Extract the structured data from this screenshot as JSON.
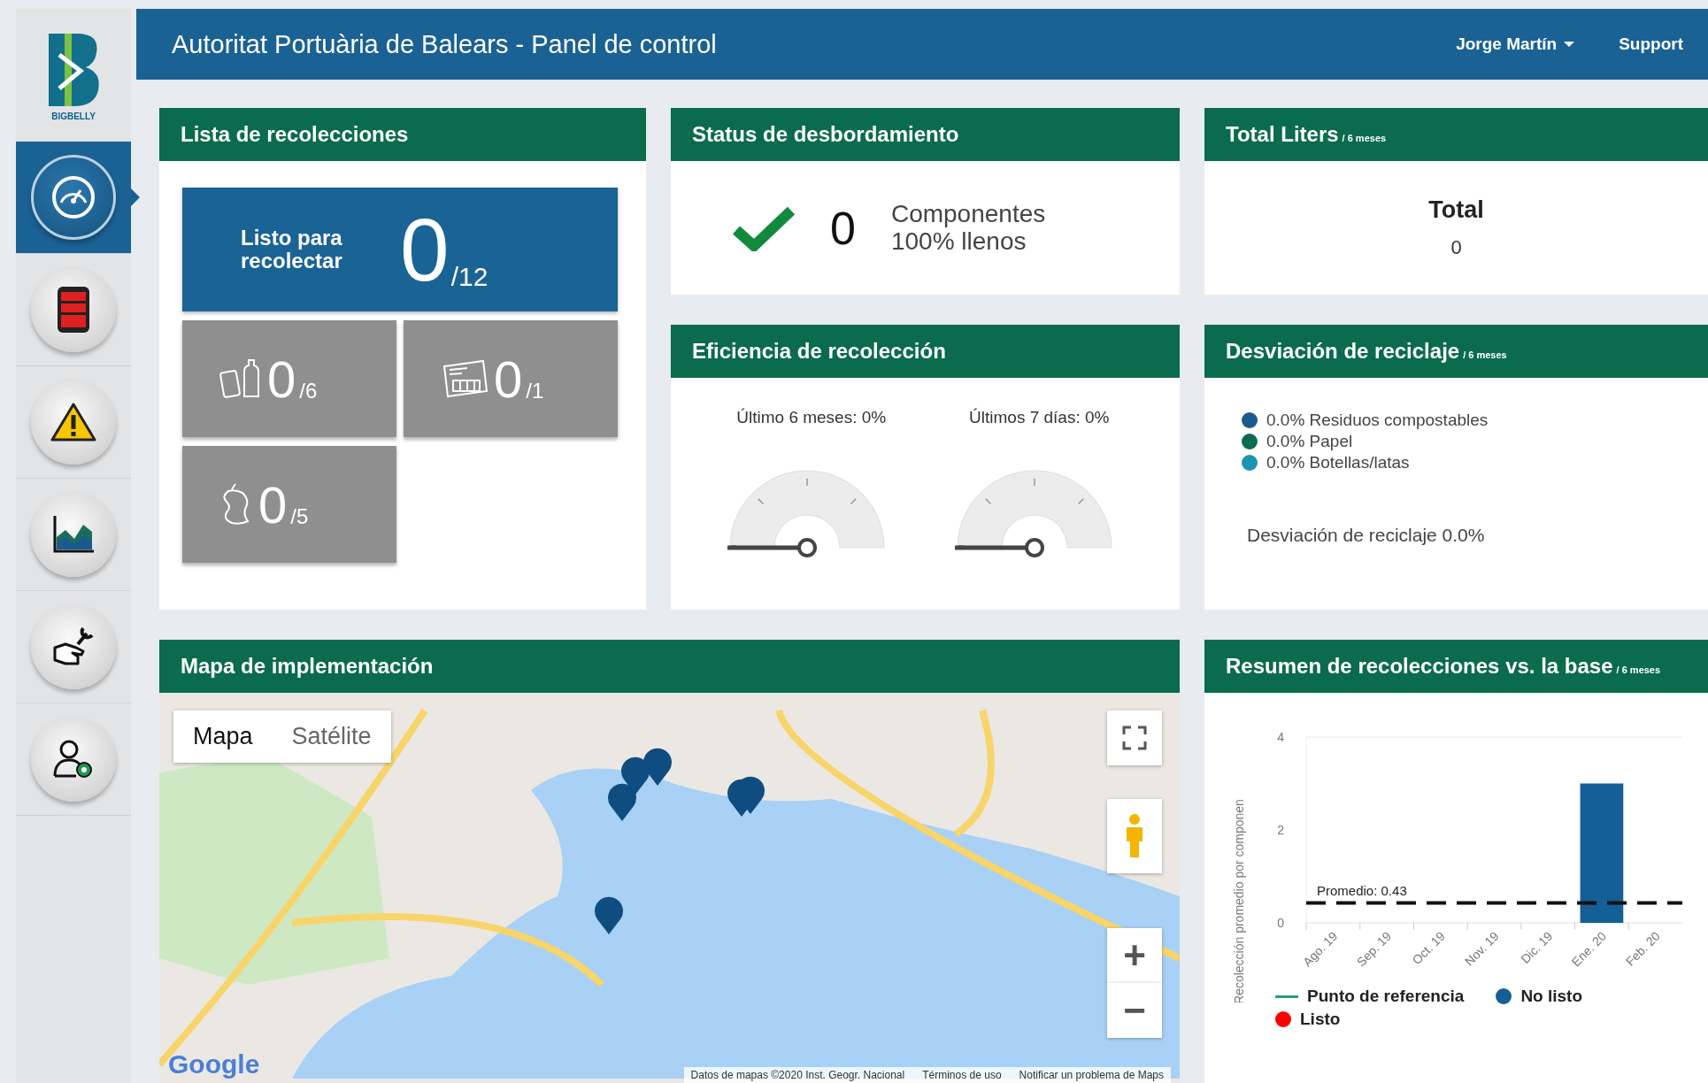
{
  "sidebar": {
    "logo_text": "BIGBELLY",
    "items": [
      {
        "kind": "gauge",
        "selected": true
      },
      {
        "kind": "bin",
        "selected": false
      },
      {
        "kind": "warning",
        "selected": false
      },
      {
        "kind": "chart",
        "selected": false
      },
      {
        "kind": "service",
        "selected": false
      },
      {
        "kind": "user",
        "selected": false
      }
    ]
  },
  "header": {
    "title": "Autoritat Portuària de Balears - Panel de control",
    "user": "Jorge Martín",
    "support": "Support"
  },
  "collections": {
    "title": "Lista de recolecciones",
    "ready": {
      "label": "Listo para recolectar",
      "value": "0",
      "total": "/12"
    },
    "streams": [
      {
        "kind": "bottles",
        "value": "0",
        "total": "/6"
      },
      {
        "kind": "paper",
        "value": "0",
        "total": "/1"
      },
      {
        "kind": "compost",
        "value": "0",
        "total": "/5"
      }
    ]
  },
  "overflow": {
    "title": "Status de desbordamiento",
    "count": "0",
    "label": "Componentes 100% llenos"
  },
  "total_liters": {
    "title": "Total Liters",
    "period": "/ 6 meses",
    "label": "Total",
    "value": "0"
  },
  "efficiency": {
    "title": "Eficiencia de recolección",
    "gauges": [
      {
        "label": "Último 6 meses: 0%",
        "level": 0
      },
      {
        "label": "Últimos 7 días: 0%",
        "level": 0
      }
    ]
  },
  "recycling": {
    "title": "Desviación de reciclaje",
    "period": "/ 6 meses",
    "legend": [
      {
        "label": "0.0% Residuos compostables",
        "color": "#1b5a8c"
      },
      {
        "label": "0.0% Papel",
        "color": "#0b6b52"
      },
      {
        "label": "0.0% Botellas/latas",
        "color": "#1c95b5"
      }
    ],
    "summary": "Desviación de reciclaje 0.0%"
  },
  "map": {
    "title": "Mapa de implementación",
    "types": [
      {
        "label": "Mapa",
        "selected": true
      },
      {
        "label": "Satélite",
        "selected": false
      }
    ],
    "zoom_in": "+",
    "zoom_out": "−",
    "logo": "Google",
    "attribution": [
      "Datos de mapas ©2020 Inst. Geogr. Nacional",
      "Términos de uso",
      "Notificar un problema de Maps"
    ]
  },
  "summary_chart": {
    "title": "Resumen de recolecciones vs. la base",
    "period": "/ 6 meses",
    "reference": {
      "name": "Punto de referencia",
      "color": "#2a9d78"
    },
    "chart_data": {
      "type": "bar",
      "ylabel": "Recolección promedio por componen",
      "categories": [
        "Ago. 19",
        "Sep. 19",
        "Oct. 19",
        "Nov. 19",
        "Dic. 19",
        "Ene. 20",
        "Feb. 20"
      ],
      "series": [
        {
          "name": "No listo",
          "color": "#135f96",
          "values": [
            0,
            0,
            0,
            0,
            0,
            3,
            0
          ]
        },
        {
          "name": "Listo",
          "color": "#ff0000",
          "values": [
            0,
            0,
            0,
            0,
            0,
            0,
            0
          ]
        }
      ],
      "ylim": [
        0,
        4
      ],
      "yticks": [
        0,
        2,
        4
      ],
      "stacked": true,
      "ref_lines": [
        {
          "axis": "y",
          "value": 0.43,
          "label": "Promedio: 0.43"
        }
      ]
    }
  }
}
